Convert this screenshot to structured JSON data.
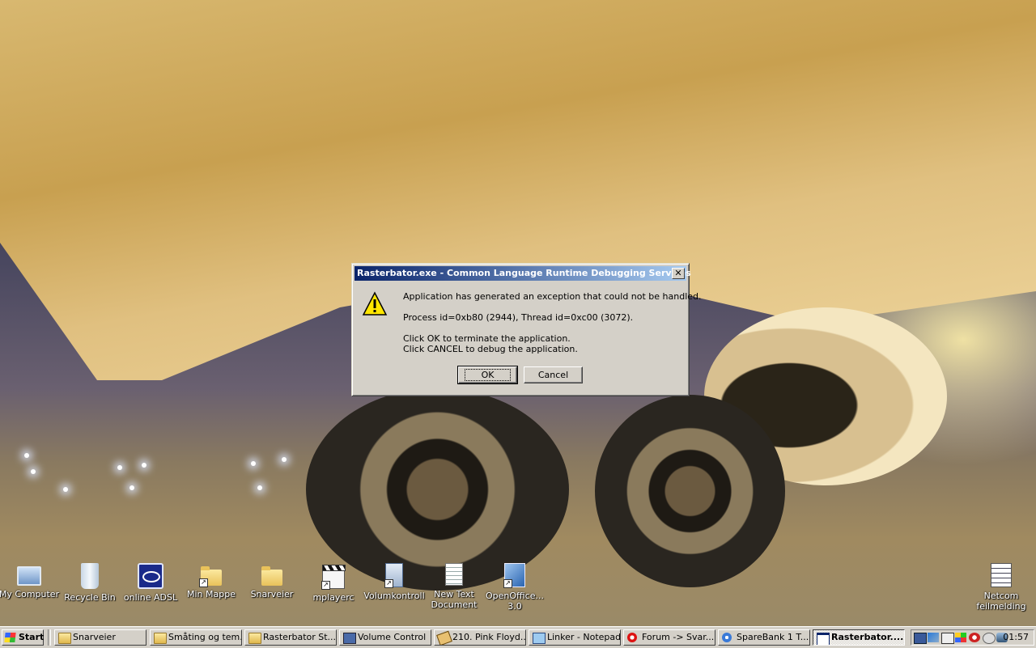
{
  "desktop": {
    "icons": [
      {
        "label": "My Computer"
      },
      {
        "label": "Recycle Bin"
      },
      {
        "label": "online ADSL"
      },
      {
        "label": "Min Mappe"
      },
      {
        "label": "Snarveier"
      },
      {
        "label": "mplayerc"
      },
      {
        "label": "Volumkontroll"
      },
      {
        "label": "New Text Document"
      },
      {
        "label": "OpenOffice... 3.0"
      },
      {
        "label": "Netcom feilmelding"
      }
    ]
  },
  "dialog": {
    "title": "Rasterbator.exe - Common Language Runtime Debugging Services",
    "close_glyph": "✕",
    "line1": "Application has generated an exception that could not be handled.",
    "line2": "Process id=0xb80 (2944), Thread id=0xc00 (3072).",
    "line3": "Click OK to terminate the application.",
    "line4": "Click CANCEL to debug the application.",
    "ok_label": "OK",
    "cancel_label": "Cancel"
  },
  "taskbar": {
    "start_label": "Start",
    "buttons": [
      {
        "label": "Snarveier",
        "icon": "folder-icon"
      },
      {
        "label": "Småting og tem...",
        "icon": "folder-icon"
      },
      {
        "label": "Rasterbator St...",
        "icon": "folder-icon"
      },
      {
        "label": "Volume Control",
        "icon": "volume-icon"
      },
      {
        "label": "210. Pink Floyd...",
        "icon": "media-icon"
      },
      {
        "label": "Linker - Notepad",
        "icon": "notepad-icon"
      },
      {
        "label": "Forum -> Svar...",
        "icon": "opera-icon"
      },
      {
        "label": "SpareBank 1 T...",
        "icon": "ie-icon"
      },
      {
        "label": "Rasterbator....",
        "icon": "app-icon",
        "active": true
      }
    ],
    "clock": "01:57"
  },
  "colors": {
    "titlebar_start": "#0a246a",
    "titlebar_end": "#a6caf0",
    "dialog_face": "#d4d0c8"
  }
}
